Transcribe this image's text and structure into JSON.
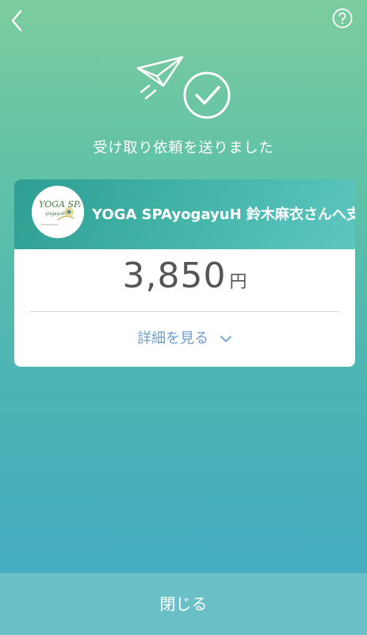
{
  "header": {
    "back_icon": "chevron-left-icon",
    "help_icon": "question-circle-icon"
  },
  "hero": {
    "icon": "paper-plane-check-icon"
  },
  "message": "受け取り依頼を送りました",
  "card": {
    "merchant_logo_text": "YOGA SPA",
    "merchant_text": "YOGA SPAyogayuH 鈴木麻衣さんへ支払",
    "amount": "3,850",
    "currency": "円",
    "details_label": "詳細を見る"
  },
  "footer": {
    "close_label": "閉じる"
  },
  "colors": {
    "accent_blue": "#6c9fd1",
    "text_gray": "#555555"
  }
}
